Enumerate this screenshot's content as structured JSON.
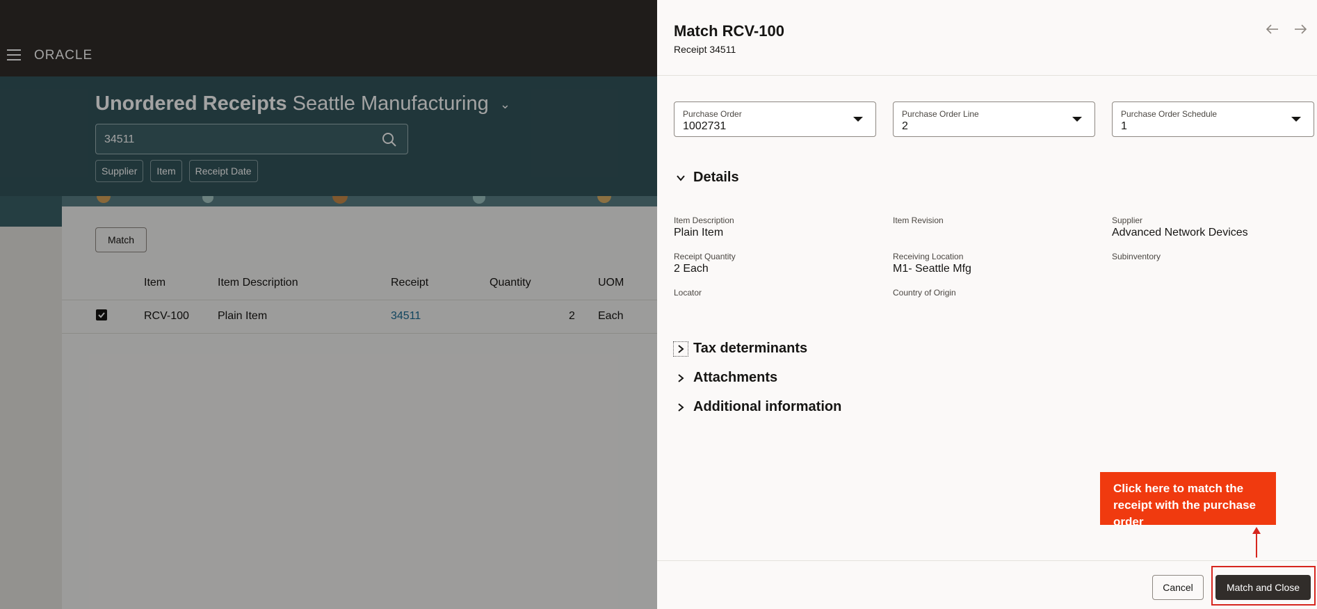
{
  "app": {
    "brand": "ORACLE"
  },
  "page": {
    "title_main": "Unordered Receipts",
    "title_context": "Seattle Manufacturing",
    "search_value": "34511",
    "filters": [
      "Supplier",
      "Item",
      "Receipt Date"
    ],
    "match_label": "Match"
  },
  "table": {
    "columns": [
      "Item",
      "Item Description",
      "Receipt",
      "Quantity",
      "UOM"
    ],
    "rows": [
      {
        "selected": true,
        "item": "RCV-100",
        "description": "Plain Item",
        "receipt": "34511",
        "quantity": "2",
        "uom": "Each"
      }
    ]
  },
  "drawer": {
    "title": "Match RCV-100",
    "subtitle": "Receipt 34511",
    "selects": [
      {
        "label": "Purchase Order",
        "value": "1002731"
      },
      {
        "label": "Purchase Order Line",
        "value": "2"
      },
      {
        "label": "Purchase Order Schedule",
        "value": "1"
      }
    ],
    "details": {
      "heading": "Details",
      "fields": [
        {
          "label": "Item Description",
          "value": "Plain Item"
        },
        {
          "label": "Item Revision",
          "value": ""
        },
        {
          "label": "Supplier",
          "value": "Advanced Network Devices"
        },
        {
          "label": "Receipt Quantity",
          "value": "2 Each"
        },
        {
          "label": "Receiving Location",
          "value": "M1- Seattle Mfg"
        },
        {
          "label": "Subinventory",
          "value": ""
        },
        {
          "label": "Locator",
          "value": ""
        },
        {
          "label": "Country of Origin",
          "value": ""
        }
      ]
    },
    "sections": [
      "Tax determinants",
      "Attachments",
      "Additional information"
    ],
    "cancel_label": "Cancel",
    "confirm_label": "Match and Close"
  },
  "callout": {
    "text": "Click here to match the receipt with the purchase order"
  },
  "colors": {
    "topbar": "#312d2a",
    "banner": "#33555b",
    "link": "#1b6c95",
    "callout": "#f03a0f",
    "primary_button": "#312d2a"
  }
}
